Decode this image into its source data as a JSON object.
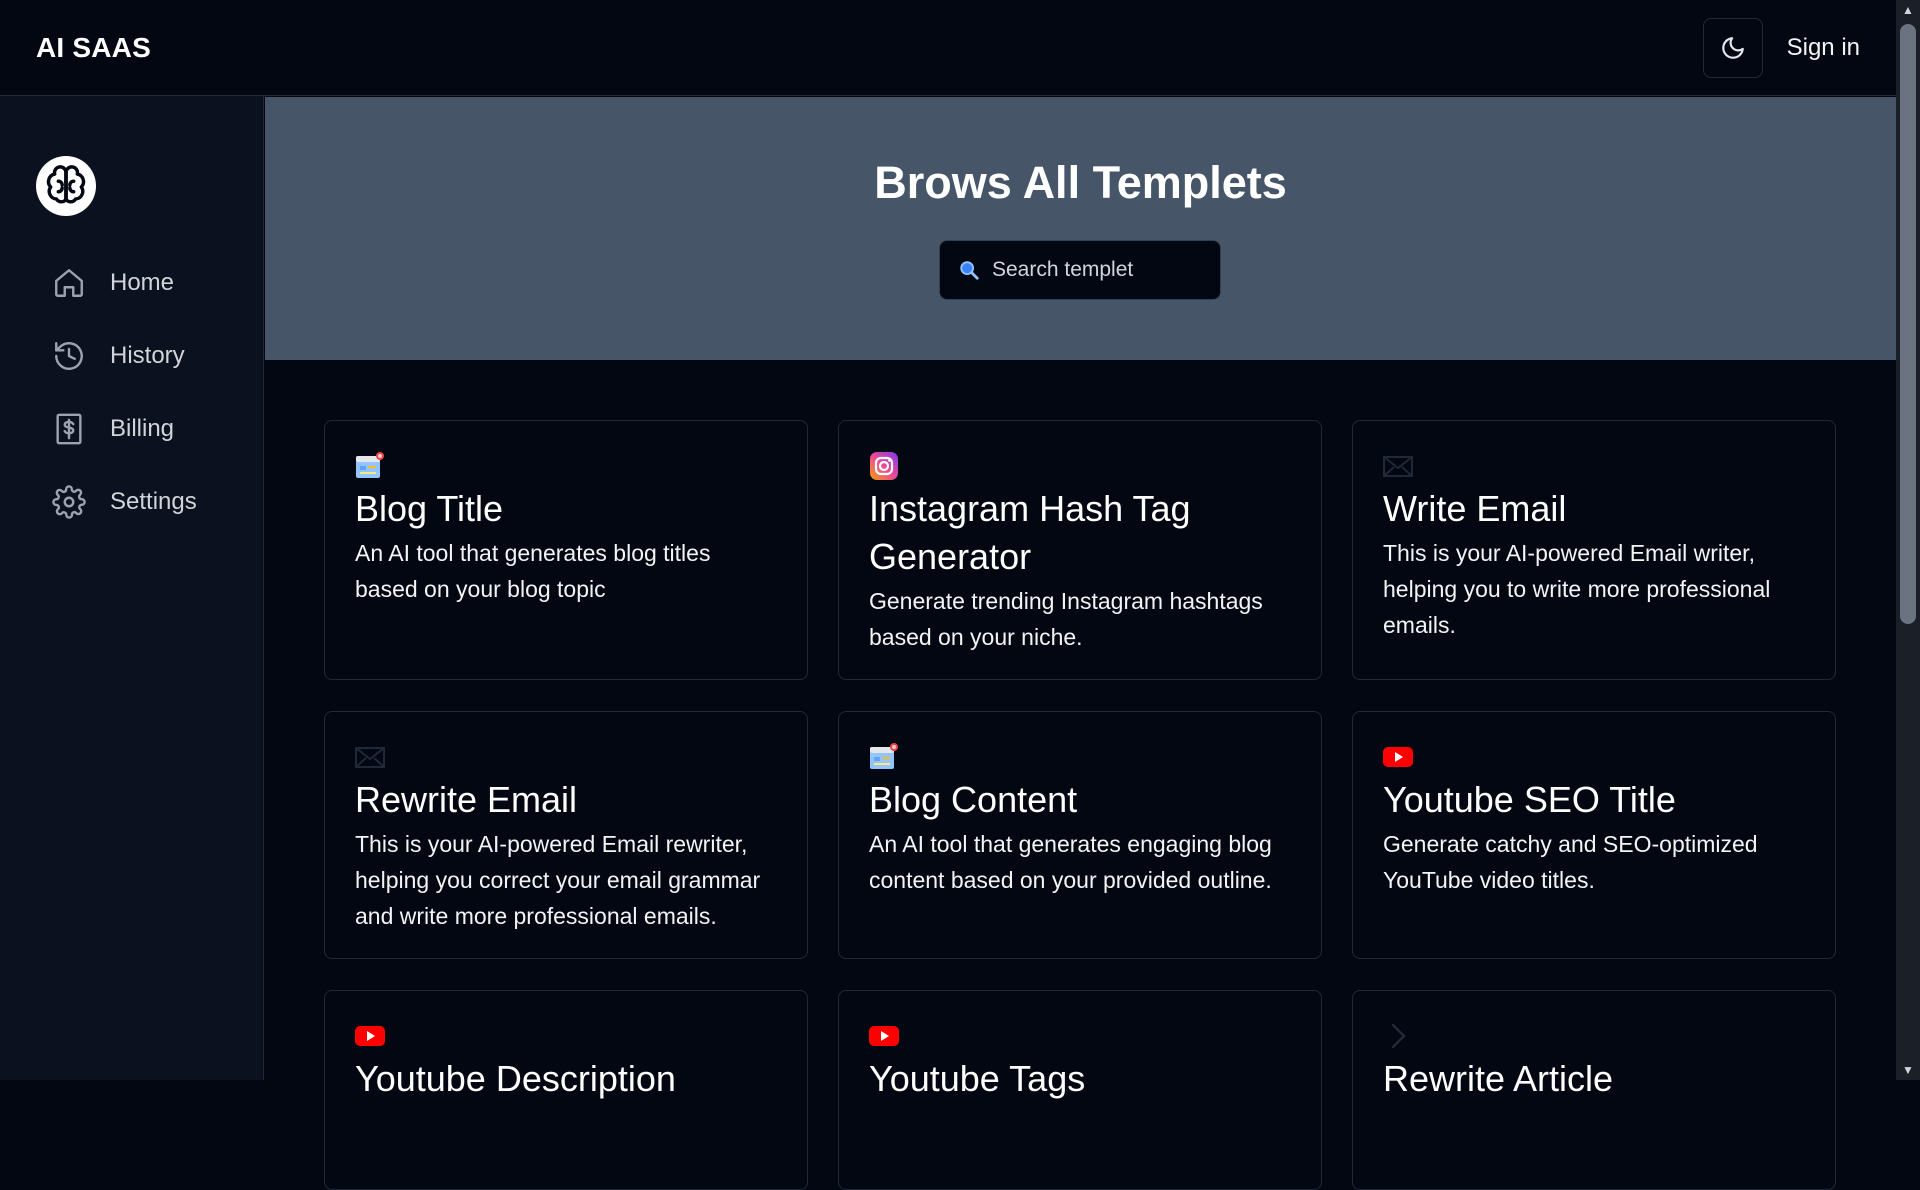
{
  "header": {
    "brand": "AI SAAS",
    "sign_in_label": "Sign in",
    "theme_icon": "moon-icon"
  },
  "sidebar": {
    "logo_icon": "brain-icon",
    "items": [
      {
        "label": "Home",
        "icon": "home-icon"
      },
      {
        "label": "History",
        "icon": "history-icon"
      },
      {
        "label": "Billing",
        "icon": "billing-icon"
      },
      {
        "label": "Settings",
        "icon": "gear-icon"
      }
    ]
  },
  "hero": {
    "title": "Brows All Templets",
    "search_placeholder": "Search templet"
  },
  "templates": [
    {
      "title": "Blog Title",
      "desc": "An AI tool that generates blog titles based on your blog topic",
      "icon": "blog-icon"
    },
    {
      "title": "Instagram Hash Tag Generator",
      "desc": "Generate trending Instagram hashtags based on your niche.",
      "icon": "instagram-icon"
    },
    {
      "title": "Write Email",
      "desc": "This is your AI-powered Email writer, helping you to write more professional emails.",
      "icon": "email-icon"
    },
    {
      "title": "Rewrite Email",
      "desc": "This is your AI-powered Email rewriter, helping you correct your email grammar and write more professional emails.",
      "icon": "email-icon"
    },
    {
      "title": "Blog Content",
      "desc": "An AI tool that generates engaging blog content based on your provided outline.",
      "icon": "blog-icon"
    },
    {
      "title": "Youtube SEO Title",
      "desc": "Generate catchy and SEO-optimized YouTube video titles.",
      "icon": "youtube-icon"
    },
    {
      "title": "Youtube Description",
      "desc": "",
      "icon": "youtube-icon"
    },
    {
      "title": "Youtube Tags",
      "desc": "",
      "icon": "youtube-icon"
    },
    {
      "title": "Rewrite Article",
      "desc": "",
      "icon": "chevron-right-icon"
    }
  ],
  "colors": {
    "background": "#030712",
    "sidebar": "#0b111e",
    "hero": "#475569",
    "youtube_red": "#ff0000"
  }
}
